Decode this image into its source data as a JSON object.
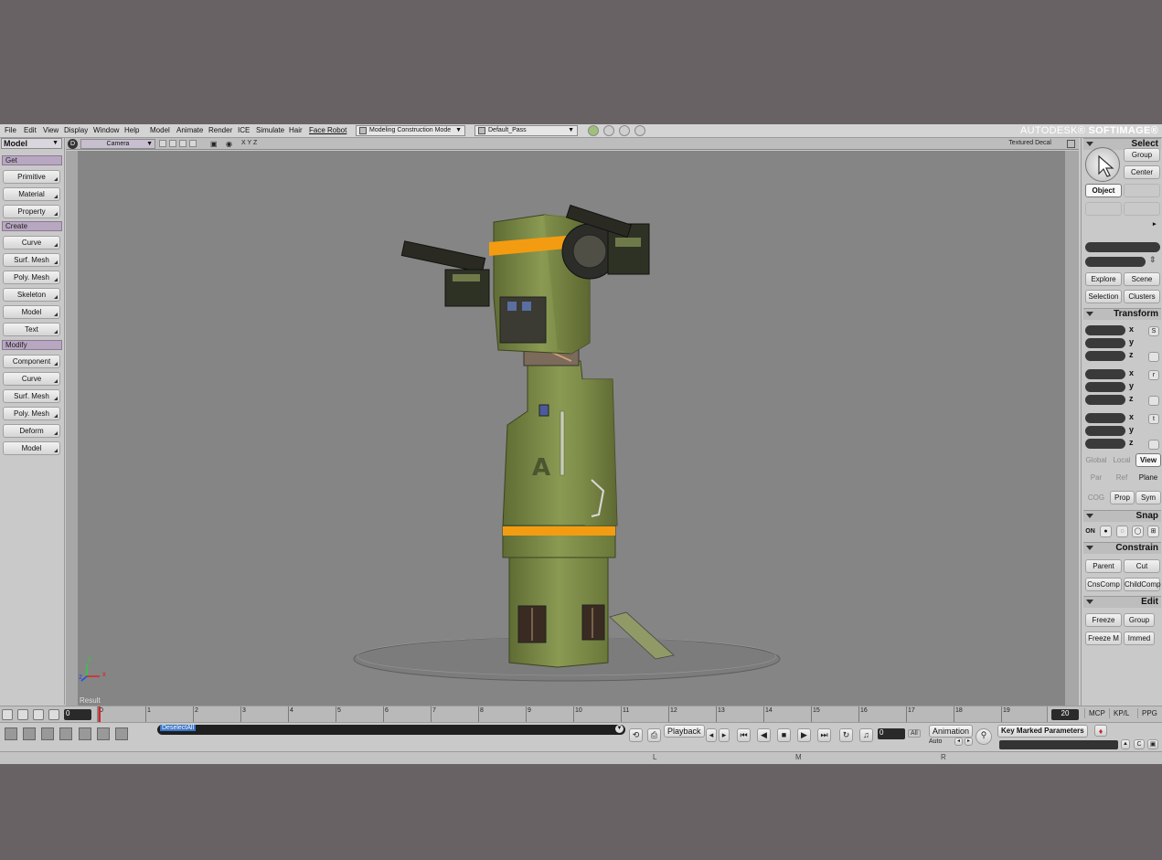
{
  "menu": {
    "items": [
      "File",
      "Edit",
      "View",
      "Display",
      "Window",
      "Help",
      "Model",
      "Animate",
      "Render",
      "ICE",
      "Simulate",
      "Hair",
      "Face Robot"
    ],
    "mode_select": "Modeling Construction Mode",
    "pass_select": "Default_Pass",
    "brand_prefix": "AUTODESK®",
    "brand_name": "SOFTIMAGE®"
  },
  "left_panel": {
    "toolbar": "Model",
    "sections": [
      {
        "title": "Get",
        "items": [
          "Primitive",
          "Material",
          "Property"
        ]
      },
      {
        "title": "Create",
        "items": [
          "Curve",
          "Surf. Mesh",
          "Poly. Mesh",
          "Skeleton",
          "Model",
          "Text"
        ]
      },
      {
        "title": "Modify",
        "items": [
          "Component",
          "Curve",
          "Surf. Mesh",
          "Poly. Mesh",
          "Deform",
          "Model"
        ]
      }
    ]
  },
  "viewport": {
    "menu_glyph": "D",
    "camera": "Camera",
    "axes_label": "X Y Z",
    "display_mode": "Textured Decal",
    "result_label": "Result",
    "axis_x": "x",
    "axis_y": "y",
    "axis_z": "z",
    "background": "#858585"
  },
  "right_panel": {
    "select": {
      "title": "Select",
      "buttons": [
        "Group",
        "Center"
      ],
      "object": "Object",
      "explore": "Explore",
      "scene": "Scene",
      "selection": "Selection",
      "clusters": "Clusters"
    },
    "transform": {
      "title": "Transform",
      "axes": [
        "x",
        "y",
        "z"
      ],
      "scale_icon": "S",
      "rotate_icon": "r",
      "translate_icon": "t",
      "global": "Global",
      "local": "Local",
      "view": "View",
      "par": "Par",
      "ref": "Ref",
      "plane": "Plane",
      "cog": "COG",
      "prop": "Prop",
      "sym": "Sym"
    },
    "snap": {
      "title": "Snap",
      "on": "ON"
    },
    "constrain": {
      "title": "Constrain",
      "buttons": [
        "Parent",
        "Cut",
        "CnsComp",
        "ChildComp"
      ]
    },
    "edit": {
      "title": "Edit",
      "buttons": [
        "Freeze",
        "Group",
        "Freeze M",
        "Immed"
      ]
    }
  },
  "timeline": {
    "start_frame": "0",
    "end_frame": "20",
    "current_frame": 0,
    "ticks": [
      "0",
      "1",
      "2",
      "3",
      "4",
      "5",
      "6",
      "7",
      "8",
      "9",
      "10",
      "11",
      "12",
      "13",
      "14",
      "15",
      "16",
      "17",
      "18",
      "19"
    ],
    "tabs": [
      "MCP",
      "KP/L",
      "PPG"
    ]
  },
  "bottom": {
    "command_text": "DeselectAll",
    "playback": "Playback",
    "frame_value": "0",
    "all_label": "All",
    "animation": "Animation",
    "auto": "Auto",
    "key_marked": "Key Marked Parameters",
    "mouse_l": "L",
    "mouse_m": "M",
    "mouse_r": "R"
  },
  "colors": {
    "section_header": "#b8a7c1",
    "accent_stripe": "#f39c12",
    "robot_body": "#7a8a45"
  }
}
